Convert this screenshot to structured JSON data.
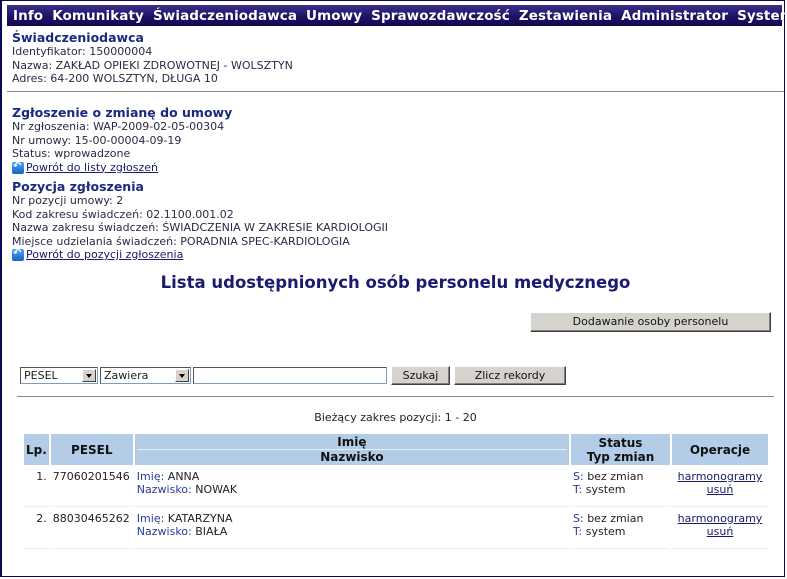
{
  "menu": [
    "Info",
    "Komunikaty",
    "Świadczeniodawca",
    "Umowy",
    "Sprawozdawczość",
    "Zestawienia",
    "Administrator",
    "System"
  ],
  "provider": {
    "heading": "Świadczeniodawca",
    "id_line": "Identyfikator: 150000004",
    "name_line": "Nazwa: ZAKŁAD OPIEKI ZDROWOTNEJ - WOLSZTYN",
    "address_line": "Adres: 64-200 WOLSZTYN, DŁUGA 10"
  },
  "request": {
    "heading": "Zgłoszenie o zmianę do umowy",
    "number_line": "Nr zgłoszenia: WAP-2009-02-05-00304",
    "contract_line": "Nr umowy: 15-00-00004-09-19",
    "status_line": "Status: wprowadzone",
    "back_link": "Powrót do listy zgłoszeń"
  },
  "position": {
    "heading": "Pozycja zgłoszenia",
    "pos_line": "Nr pozycji umowy: 2",
    "code_line": "Kod zakresu świadczeń: 02.1100.001.02",
    "range_name_line": "Nazwa zakresu świadczeń: ŚWIADCZENIA W ZAKRESIE KARDIOLOGII",
    "place_line": "Miejsce udzielania świadczeń: PORADNIA SPEC-KARDIOLOGIA",
    "back_link": "Powrót do pozycji zgłoszenia"
  },
  "page_title": "Lista udostępnionych osób personelu medycznego",
  "add_button": "Dodawanie osoby personelu",
  "filter": {
    "field_value": "PESEL",
    "operator_value": "Zawiera",
    "search_value": "",
    "search_button": "Szukaj",
    "count_button": "Zlicz rekordy"
  },
  "range_text": "Bieżący zakres pozycji: 1 - 20",
  "table": {
    "headers": {
      "lp": "Lp.",
      "pesel": "PESEL",
      "name_top": "Imię",
      "name_bottom": "Nazwisko",
      "status_top": "Status",
      "status_bottom": "Typ zmian",
      "ops": "Operacje"
    },
    "rows": [
      {
        "lp": "1.",
        "pesel": "77060201546",
        "first_label": "Imię:",
        "first": "ANNA",
        "last_label": "Nazwisko:",
        "last": "NOWAK",
        "s_label": "S:",
        "s": "bez zmian",
        "t_label": "T:",
        "t": "system",
        "op1": "harmonogramy",
        "op2": "usuń"
      },
      {
        "lp": "2.",
        "pesel": "88030465262",
        "first_label": "Imię:",
        "first": "KATARZYNA",
        "last_label": "Nazwisko:",
        "last": "BIAŁA",
        "s_label": "S:",
        "s": "bez zmian",
        "t_label": "T:",
        "t": "system",
        "op1": "harmonogramy",
        "op2": "usuń"
      }
    ]
  }
}
